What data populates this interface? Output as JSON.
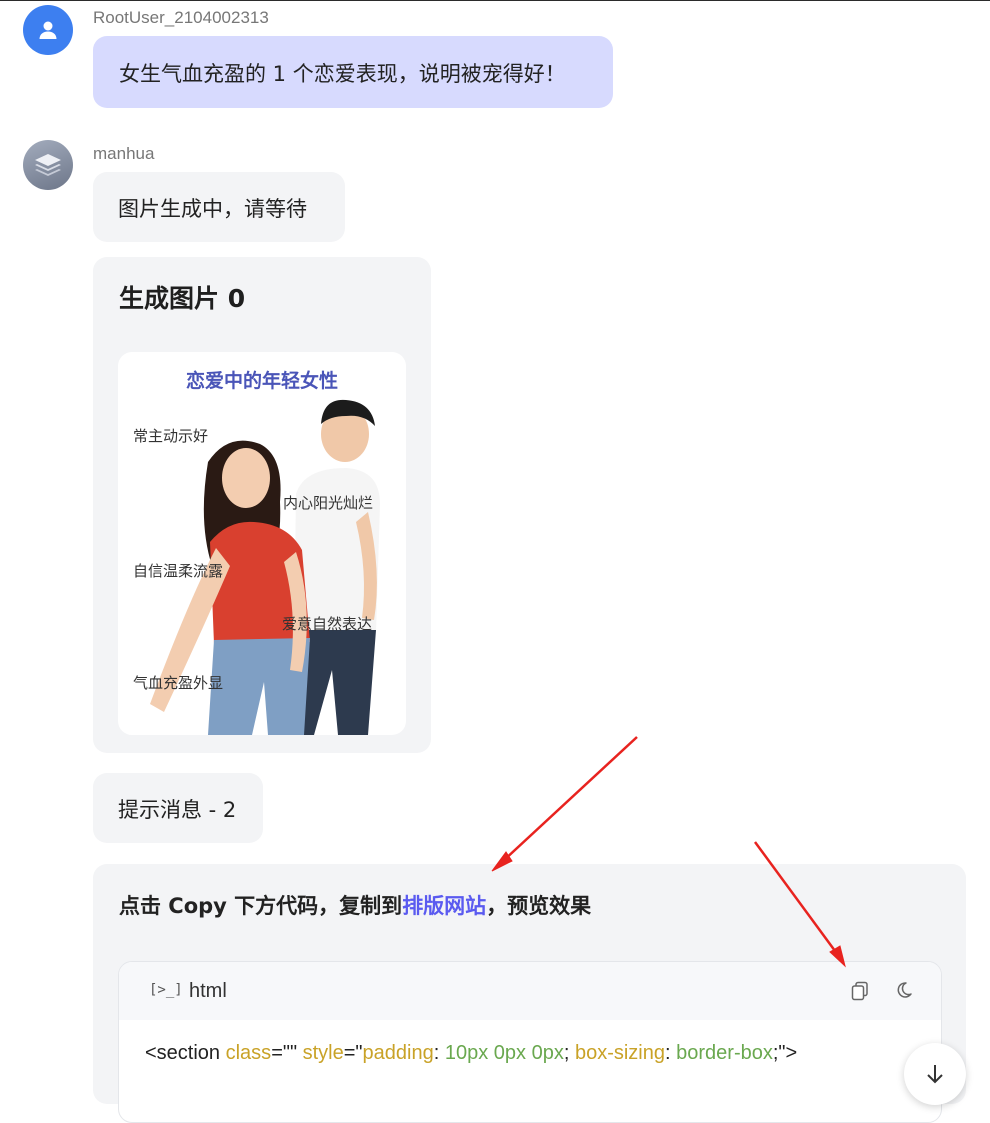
{
  "user": {
    "name": "RootUser_2104002313",
    "message": "女生气血充盈的 1 个恋爱表现，说明被宠得好！"
  },
  "bot": {
    "name": "manhua",
    "waiting_message": "图片生成中，请等待",
    "image_card": {
      "title": "生成图片 0",
      "poster": {
        "title": "恋爱中的年轻女性",
        "labels": [
          "常主动示好",
          "内心阳光灿烂",
          "自信温柔流露",
          "爱意自然表达",
          "气血充盈外显"
        ]
      }
    },
    "hint_message": "提示消息 - 2",
    "code_card": {
      "instruction_prefix": "点击 Copy 下方代码，复制到",
      "instruction_link": "排版网站",
      "instruction_suffix": "，预览效果",
      "code_block": {
        "language": "html",
        "terminal_glyph": "[>_]",
        "line": {
          "t1": "<section ",
          "t2": "class",
          "t3": "=\"\" ",
          "t4": "style",
          "t5": "=\"",
          "t6": "padding",
          "t7": ": ",
          "t8": "10px 0px 0px",
          "t9": "; ",
          "t10": "box-sizing",
          "t11": ": ",
          "t12": "border-box",
          "t13": ";\">"
        }
      }
    }
  },
  "colors": {
    "user_bubble": "#d7dafe",
    "bot_bubble": "#f3f4f6",
    "avatar_user": "#3d7ff0",
    "link": "#5a5af0",
    "poster_title": "#4a55b8",
    "annotation_arrow": "#e8231f"
  },
  "icons": {
    "avatar_user": "person-icon",
    "avatar_bot": "layers-icon",
    "copy": "copy-icon",
    "theme": "moon-icon",
    "scroll_down": "arrow-down-icon"
  }
}
